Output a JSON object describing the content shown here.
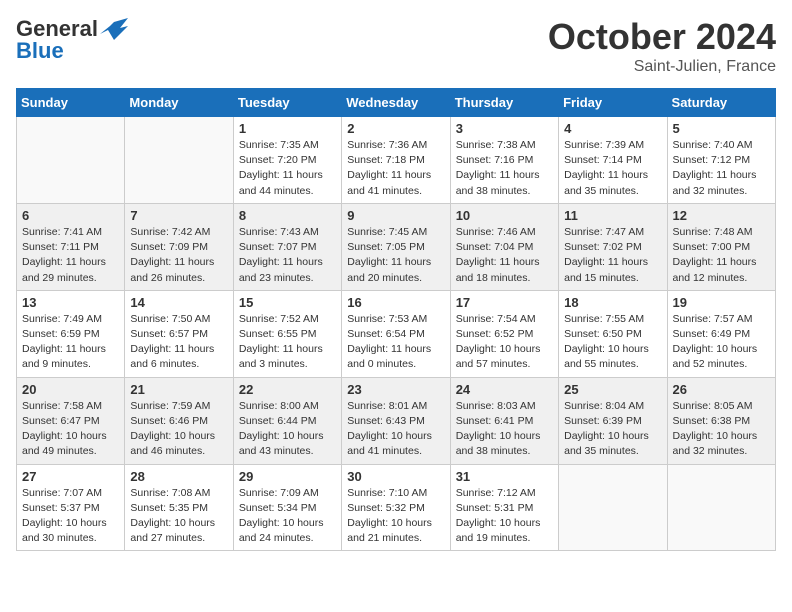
{
  "header": {
    "logo_general": "General",
    "logo_blue": "Blue",
    "month_title": "October 2024",
    "location": "Saint-Julien, France"
  },
  "days_of_week": [
    "Sunday",
    "Monday",
    "Tuesday",
    "Wednesday",
    "Thursday",
    "Friday",
    "Saturday"
  ],
  "weeks": [
    [
      {
        "day": "",
        "info": ""
      },
      {
        "day": "",
        "info": ""
      },
      {
        "day": "1",
        "info": "Sunrise: 7:35 AM\nSunset: 7:20 PM\nDaylight: 11 hours\nand 44 minutes."
      },
      {
        "day": "2",
        "info": "Sunrise: 7:36 AM\nSunset: 7:18 PM\nDaylight: 11 hours\nand 41 minutes."
      },
      {
        "day": "3",
        "info": "Sunrise: 7:38 AM\nSunset: 7:16 PM\nDaylight: 11 hours\nand 38 minutes."
      },
      {
        "day": "4",
        "info": "Sunrise: 7:39 AM\nSunset: 7:14 PM\nDaylight: 11 hours\nand 35 minutes."
      },
      {
        "day": "5",
        "info": "Sunrise: 7:40 AM\nSunset: 7:12 PM\nDaylight: 11 hours\nand 32 minutes."
      }
    ],
    [
      {
        "day": "6",
        "info": "Sunrise: 7:41 AM\nSunset: 7:11 PM\nDaylight: 11 hours\nand 29 minutes."
      },
      {
        "day": "7",
        "info": "Sunrise: 7:42 AM\nSunset: 7:09 PM\nDaylight: 11 hours\nand 26 minutes."
      },
      {
        "day": "8",
        "info": "Sunrise: 7:43 AM\nSunset: 7:07 PM\nDaylight: 11 hours\nand 23 minutes."
      },
      {
        "day": "9",
        "info": "Sunrise: 7:45 AM\nSunset: 7:05 PM\nDaylight: 11 hours\nand 20 minutes."
      },
      {
        "day": "10",
        "info": "Sunrise: 7:46 AM\nSunset: 7:04 PM\nDaylight: 11 hours\nand 18 minutes."
      },
      {
        "day": "11",
        "info": "Sunrise: 7:47 AM\nSunset: 7:02 PM\nDaylight: 11 hours\nand 15 minutes."
      },
      {
        "day": "12",
        "info": "Sunrise: 7:48 AM\nSunset: 7:00 PM\nDaylight: 11 hours\nand 12 minutes."
      }
    ],
    [
      {
        "day": "13",
        "info": "Sunrise: 7:49 AM\nSunset: 6:59 PM\nDaylight: 11 hours\nand 9 minutes."
      },
      {
        "day": "14",
        "info": "Sunrise: 7:50 AM\nSunset: 6:57 PM\nDaylight: 11 hours\nand 6 minutes."
      },
      {
        "day": "15",
        "info": "Sunrise: 7:52 AM\nSunset: 6:55 PM\nDaylight: 11 hours\nand 3 minutes."
      },
      {
        "day": "16",
        "info": "Sunrise: 7:53 AM\nSunset: 6:54 PM\nDaylight: 11 hours\nand 0 minutes."
      },
      {
        "day": "17",
        "info": "Sunrise: 7:54 AM\nSunset: 6:52 PM\nDaylight: 10 hours\nand 57 minutes."
      },
      {
        "day": "18",
        "info": "Sunrise: 7:55 AM\nSunset: 6:50 PM\nDaylight: 10 hours\nand 55 minutes."
      },
      {
        "day": "19",
        "info": "Sunrise: 7:57 AM\nSunset: 6:49 PM\nDaylight: 10 hours\nand 52 minutes."
      }
    ],
    [
      {
        "day": "20",
        "info": "Sunrise: 7:58 AM\nSunset: 6:47 PM\nDaylight: 10 hours\nand 49 minutes."
      },
      {
        "day": "21",
        "info": "Sunrise: 7:59 AM\nSunset: 6:46 PM\nDaylight: 10 hours\nand 46 minutes."
      },
      {
        "day": "22",
        "info": "Sunrise: 8:00 AM\nSunset: 6:44 PM\nDaylight: 10 hours\nand 43 minutes."
      },
      {
        "day": "23",
        "info": "Sunrise: 8:01 AM\nSunset: 6:43 PM\nDaylight: 10 hours\nand 41 minutes."
      },
      {
        "day": "24",
        "info": "Sunrise: 8:03 AM\nSunset: 6:41 PM\nDaylight: 10 hours\nand 38 minutes."
      },
      {
        "day": "25",
        "info": "Sunrise: 8:04 AM\nSunset: 6:39 PM\nDaylight: 10 hours\nand 35 minutes."
      },
      {
        "day": "26",
        "info": "Sunrise: 8:05 AM\nSunset: 6:38 PM\nDaylight: 10 hours\nand 32 minutes."
      }
    ],
    [
      {
        "day": "27",
        "info": "Sunrise: 7:07 AM\nSunset: 5:37 PM\nDaylight: 10 hours\nand 30 minutes."
      },
      {
        "day": "28",
        "info": "Sunrise: 7:08 AM\nSunset: 5:35 PM\nDaylight: 10 hours\nand 27 minutes."
      },
      {
        "day": "29",
        "info": "Sunrise: 7:09 AM\nSunset: 5:34 PM\nDaylight: 10 hours\nand 24 minutes."
      },
      {
        "day": "30",
        "info": "Sunrise: 7:10 AM\nSunset: 5:32 PM\nDaylight: 10 hours\nand 21 minutes."
      },
      {
        "day": "31",
        "info": "Sunrise: 7:12 AM\nSunset: 5:31 PM\nDaylight: 10 hours\nand 19 minutes."
      },
      {
        "day": "",
        "info": ""
      },
      {
        "day": "",
        "info": ""
      }
    ]
  ]
}
